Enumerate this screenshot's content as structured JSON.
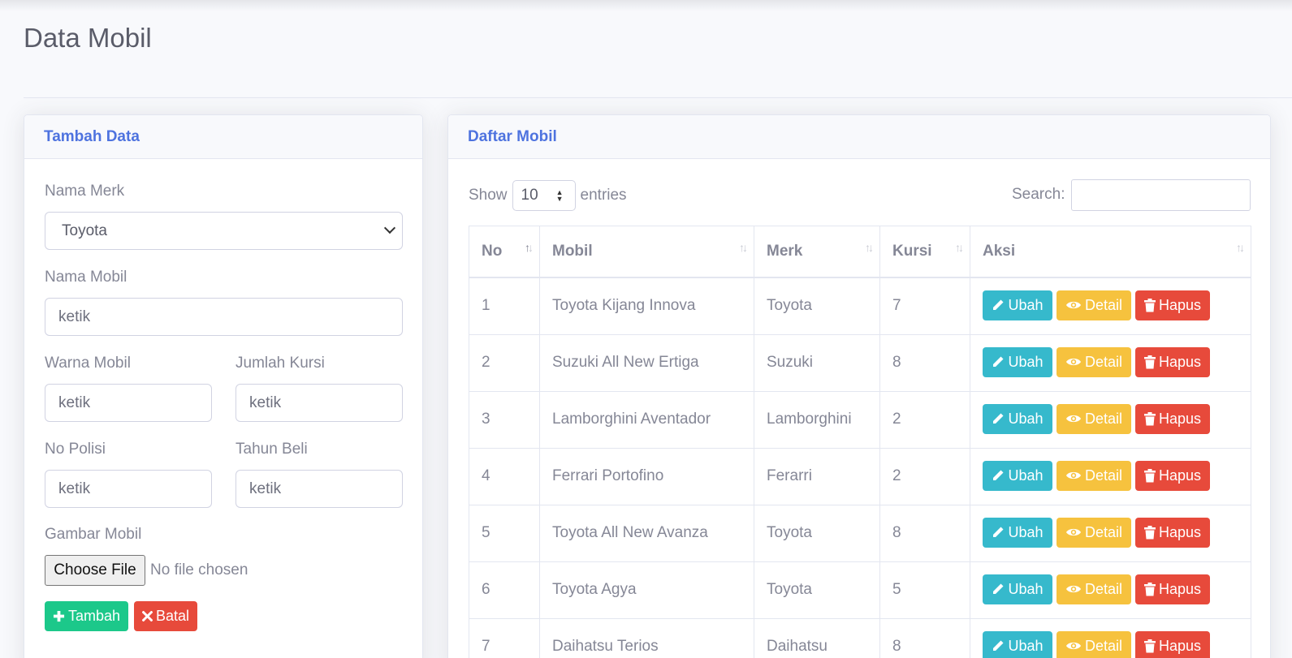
{
  "page": {
    "title": "Data Mobil"
  },
  "form": {
    "header": "Tambah Data",
    "merk_label": "Nama Merk",
    "merk_value": "Toyota",
    "mobil_label": "Nama Mobil",
    "mobil_value": "ketik",
    "warna_label": "Warna Mobil",
    "warna_value": "ketik",
    "kursi_label": "Jumlah Kursi",
    "kursi_value": "ketik",
    "polisi_label": "No Polisi",
    "polisi_value": "ketik",
    "tahun_label": "Tahun Beli",
    "tahun_value": "ketik",
    "gambar_label": "Gambar Mobil",
    "file_button": "Choose File",
    "file_status": "No file chosen",
    "tambah_label": "Tambah",
    "batal_label": "Batal"
  },
  "list": {
    "header": "Daftar Mobil",
    "show_label": "Show",
    "entries_value": "10",
    "entries_label": "entries",
    "search_label": "Search:",
    "search_value": "",
    "columns": [
      "No",
      "Mobil",
      "Merk",
      "Kursi",
      "Aksi"
    ],
    "action_labels": {
      "edit": "Ubah",
      "detail": "Detail",
      "delete": "Hapus"
    },
    "rows": [
      {
        "no": "1",
        "mobil": "Toyota Kijang Innova",
        "merk": "Toyota",
        "kursi": "7"
      },
      {
        "no": "2",
        "mobil": "Suzuki All New Ertiga",
        "merk": "Suzuki",
        "kursi": "8"
      },
      {
        "no": "3",
        "mobil": "Lamborghini Aventador",
        "merk": "Lamborghini",
        "kursi": "2"
      },
      {
        "no": "4",
        "mobil": "Ferrari Portofino",
        "merk": "Ferarri",
        "kursi": "2"
      },
      {
        "no": "5",
        "mobil": "Toyota All New Avanza",
        "merk": "Toyota",
        "kursi": "8"
      },
      {
        "no": "6",
        "mobil": "Toyota Agya",
        "merk": "Toyota",
        "kursi": "5"
      },
      {
        "no": "7",
        "mobil": "Daihatsu Terios",
        "merk": "Daihatsu",
        "kursi": "8"
      }
    ]
  },
  "icons": {
    "plus": "plus-icon",
    "times": "times-icon",
    "pencil": "pencil-icon",
    "eye": "eye-icon",
    "trash": "trash-icon"
  },
  "colors": {
    "primary": "#4e73df",
    "success": "#1cc88a",
    "danger": "#e74a3b",
    "info": "#36b9cc",
    "warning": "#f6c23e"
  }
}
